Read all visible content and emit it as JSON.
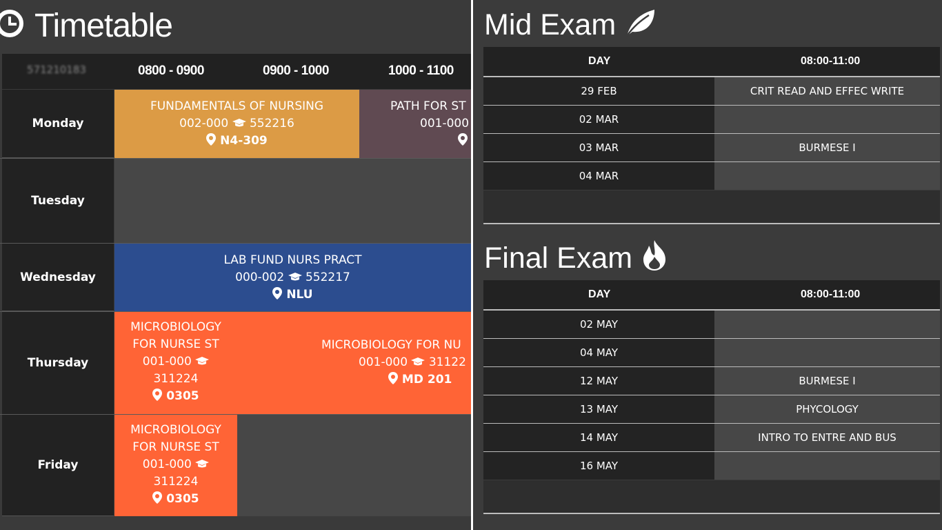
{
  "timetable": {
    "title": "Timetable",
    "student_id": "571210183",
    "hours": [
      "0800 - 0900",
      "0900 - 1000",
      "1000 - 1100"
    ],
    "days": [
      "Monday",
      "Tuesday",
      "Wednesday",
      "Thursday",
      "Friday"
    ],
    "courses": {
      "mon1": {
        "name": "FUNDAMENTALS OF NURSING",
        "sec": "002-000",
        "code": "552216",
        "room": "N4-309",
        "color": "#dc9b45"
      },
      "mon2": {
        "name": "PATH FOR ST",
        "sec": "001-000",
        "code": "",
        "room": "",
        "color": "#604a52"
      },
      "wed1": {
        "name": "LAB FUND NURS PRACT",
        "sec": "000-002",
        "code": "552217",
        "room": "NLU",
        "color": "#2c4d8f"
      },
      "thu1": {
        "name1": "MICROBIOLOGY",
        "name2": "FOR NURSE ST",
        "sec": "001-000",
        "code": "311224",
        "room": "0305",
        "color": "#ff6436"
      },
      "thu2": {
        "name": "MICROBIOLOGY FOR NU",
        "sec": "001-000",
        "code": "31122",
        "room": "MD 201",
        "color": "#ff6436"
      },
      "fri1": {
        "name1": "MICROBIOLOGY",
        "name2": "FOR NURSE ST",
        "sec": "001-000",
        "code": "311224",
        "room": "0305",
        "color": "#ff6436"
      }
    }
  },
  "mid_exam": {
    "title": "Mid Exam",
    "col_day": "DAY",
    "col_time": "08:00-11:00",
    "rows": [
      {
        "day": "29 FEB",
        "subject": "CRIT READ AND EFFEC WRITE"
      },
      {
        "day": "02 MAR",
        "subject": ""
      },
      {
        "day": "03 MAR",
        "subject": "BURMESE I"
      },
      {
        "day": "04 MAR",
        "subject": ""
      }
    ]
  },
  "final_exam": {
    "title": "Final Exam",
    "col_day": "DAY",
    "col_time": "08:00-11:00",
    "rows": [
      {
        "day": "02 MAY",
        "subject": ""
      },
      {
        "day": "04 MAY",
        "subject": ""
      },
      {
        "day": "12 MAY",
        "subject": "BURMESE I"
      },
      {
        "day": "13 MAY",
        "subject": "PHYCOLOGY"
      },
      {
        "day": "14 MAY",
        "subject": "INTRO TO ENTRE AND BUS"
      },
      {
        "day": "16 MAY",
        "subject": ""
      }
    ]
  },
  "icons": {
    "clock": "clock-icon",
    "cap": "graduation-cap-icon",
    "pin": "map-marker-icon",
    "leaf": "leaf-icon",
    "fire": "fire-icon"
  }
}
